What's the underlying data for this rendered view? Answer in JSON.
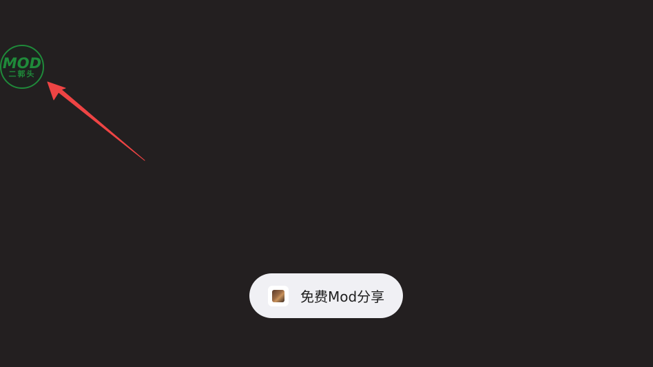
{
  "mod_badge": {
    "title": "MOD",
    "subtitle": "二郭头",
    "color": "#1f8a3a"
  },
  "pointer_arrow": {
    "color": "#ee4444"
  },
  "toast": {
    "text": "免费Mod分享",
    "icon": "app-icon"
  },
  "colors": {
    "background": "#231f20",
    "toast_background": "#f0f0f4"
  }
}
